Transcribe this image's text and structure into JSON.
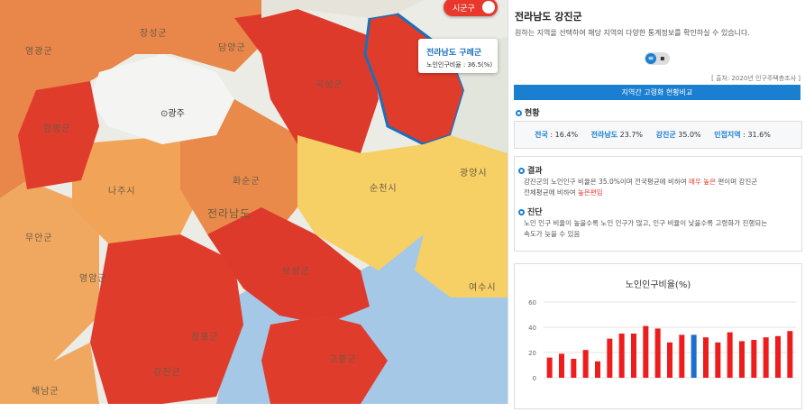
{
  "map": {
    "toggle_label": "시군구",
    "tooltip": {
      "region": "전라남도 구례군",
      "value_text": "노인인구비율 : 36.5(%)"
    },
    "gwangju": "⊙광주",
    "labels": [
      "영광군",
      "장성군",
      "담양군",
      "곡성군",
      "함평군",
      "나주시",
      "화순군",
      "전라남도",
      "순천시",
      "광양시",
      "무안군",
      "영암군",
      "보성군",
      "여수시",
      "장흥군",
      "강진군",
      "고흥군",
      "해남군",
      "담양군"
    ]
  },
  "panel": {
    "title": "전라남도 강진군",
    "description": "원하는 지역을 선택하여 해당 지역의 다양한 통계정보를 확인하실 수 있습니다.",
    "source": "[ 출처: 2020년 인구주택총조사 ]",
    "section_title": "지역간 고령화 현황비교",
    "status": {
      "heading": "현황",
      "items": [
        {
          "key": "전국",
          "value": " : 16.4%"
        },
        {
          "key": "전라남도",
          "value": " 23.7%"
        },
        {
          "key": "강진군",
          "value": " 35.0%"
        },
        {
          "key": "인접지역",
          "value": " : 31.6%"
        }
      ]
    },
    "result": {
      "heading": "결과",
      "line1_a": "강진군의 노인인구 비율은 35.0%이며 전국평균에 비하여 ",
      "line1_hl": "매우 높은",
      "line1_b": " 편이며 강진군",
      "line2_a": "전체평균에 비하여 ",
      "line2_hl": "높은편임",
      "diag_heading": "진단",
      "diag1": "노인 인구 비율이 높을수록 노인 인구가 많고, 인구 비율이 낮을수록 고령화가 진행되는",
      "diag2": "속도가 늦을 수 있음"
    }
  },
  "chart_data": {
    "type": "bar",
    "title": "노인인구비율(%)",
    "ylim": [
      0,
      60
    ],
    "yticks": [
      0,
      20,
      40,
      60
    ],
    "grid": true,
    "values": [
      16,
      19,
      15,
      22,
      13,
      31,
      35,
      35,
      41,
      39,
      28,
      34,
      34,
      32,
      28,
      36,
      29,
      30,
      32,
      33,
      37
    ],
    "highlight_index": 12,
    "colors": {
      "bar": "#ee1c1c",
      "highlight": "#1a6fd0"
    }
  }
}
